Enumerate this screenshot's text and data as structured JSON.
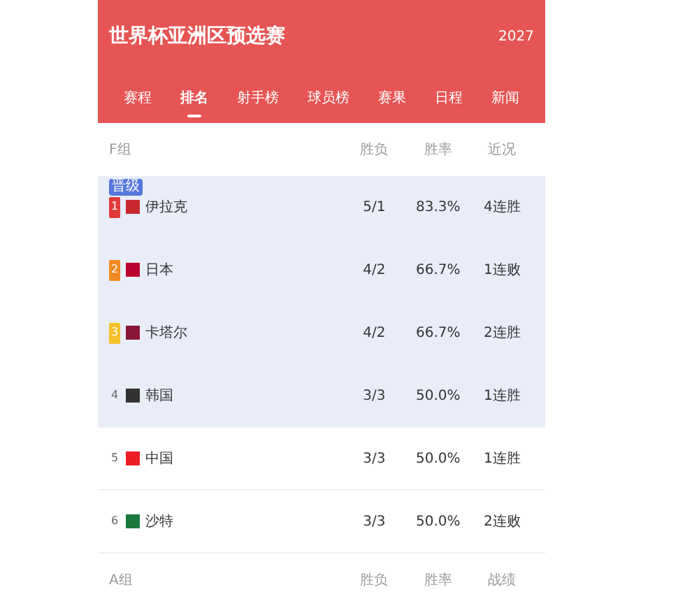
{
  "header": {
    "title": "世界杯亚洲区预选赛",
    "year": "2027"
  },
  "tabs": [
    {
      "label": "赛程",
      "selected": false
    },
    {
      "label": "排名",
      "selected": true
    },
    {
      "label": "射手榜",
      "selected": false
    },
    {
      "label": "球员榜",
      "selected": false
    },
    {
      "label": "赛果",
      "selected": false
    },
    {
      "label": "日程",
      "selected": false
    },
    {
      "label": "新闻",
      "selected": false
    }
  ],
  "groups": [
    {
      "name": "F组",
      "columns": [
        "胜负",
        "胜率",
        "近况"
      ],
      "zone_tag": "晋级",
      "rows": [
        {
          "rank": "1",
          "kind": "first",
          "color": "#c8282d",
          "team": "伊拉克",
          "record": "5/1",
          "rate": "83.3%",
          "form": "4连胜",
          "highlighted": true
        },
        {
          "rank": "2",
          "kind": "second",
          "color": "#bc002d",
          "team": "日本",
          "record": "4/2",
          "rate": "66.7%",
          "form": "1连败",
          "highlighted": true
        },
        {
          "rank": "3",
          "kind": "third",
          "color": "#8a1538",
          "team": "卡塔尔",
          "record": "4/2",
          "rate": "66.7%",
          "form": "2连胜",
          "highlighted": true
        },
        {
          "rank": "4",
          "kind": "plain",
          "color": "#333333",
          "team": "韩国",
          "record": "3/3",
          "rate": "50.0%",
          "form": "1连胜",
          "highlighted": true
        },
        {
          "rank": "5",
          "kind": "plain",
          "color": "#ee1c25",
          "team": "中国",
          "record": "3/3",
          "rate": "50.0%",
          "form": "1连胜",
          "highlighted": false
        },
        {
          "rank": "6",
          "kind": "plain",
          "color": "#1a7a3c",
          "team": "沙特",
          "record": "3/3",
          "rate": "50.0%",
          "form": "2连败",
          "highlighted": false
        }
      ]
    },
    {
      "name": "A组",
      "columns": [
        "胜负",
        "胜率",
        "战绩"
      ]
    }
  ]
}
